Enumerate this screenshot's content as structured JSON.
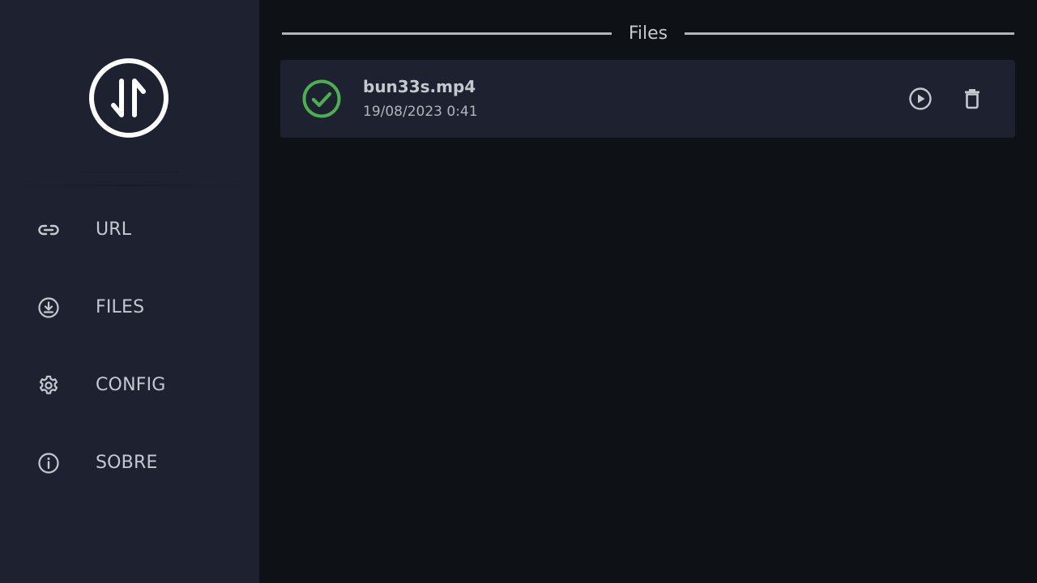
{
  "sidebar": {
    "logo_icon": "transfer-arrows-logo",
    "items": [
      {
        "label": "URL",
        "icon": "link-icon"
      },
      {
        "label": "FILES",
        "icon": "download-circle-icon"
      },
      {
        "label": "CONFIG",
        "icon": "gear-icon"
      },
      {
        "label": "SOBRE",
        "icon": "info-icon"
      }
    ]
  },
  "main": {
    "section_title": "Files",
    "files": [
      {
        "name": "bun33s.mp4",
        "date": "19/08/2023 0:41",
        "status_icon": "check-circle-icon",
        "actions": [
          "play-icon",
          "trash-icon"
        ]
      }
    ]
  },
  "colors": {
    "sidebar_bg": "#1e2230",
    "main_bg": "#0e1115",
    "card_bg": "#1e2230",
    "text": "#c4c8cf",
    "success": "#4caf50"
  }
}
